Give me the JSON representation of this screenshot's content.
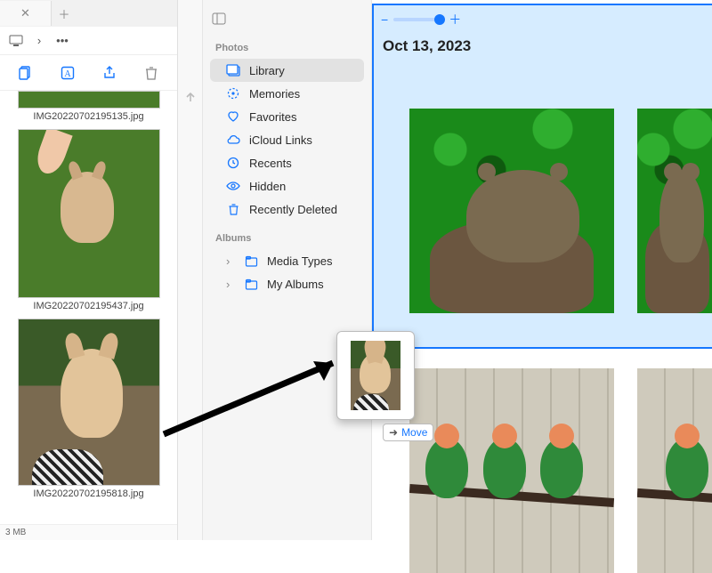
{
  "finder": {
    "toolbar": {
      "share_label": "Share",
      "delete_label": "Delete"
    },
    "files": [
      {
        "name": "IMG20220702195135.jpg"
      },
      {
        "name": "IMG20220702195437.jpg"
      },
      {
        "name": "IMG20220702195818.jpg"
      }
    ],
    "status": "3 MB"
  },
  "photos": {
    "sidebar": {
      "section1": "Photos",
      "items": [
        {
          "label": "Library"
        },
        {
          "label": "Memories"
        },
        {
          "label": "Favorites"
        },
        {
          "label": "iCloud Links"
        },
        {
          "label": "Recents"
        },
        {
          "label": "Hidden"
        },
        {
          "label": "Recently Deleted"
        }
      ],
      "section2": "Albums",
      "albums": [
        {
          "label": "Media Types"
        },
        {
          "label": "My Albums"
        }
      ]
    },
    "main": {
      "date": "Oct 13, 2023"
    },
    "drag": {
      "action": "Move"
    }
  }
}
